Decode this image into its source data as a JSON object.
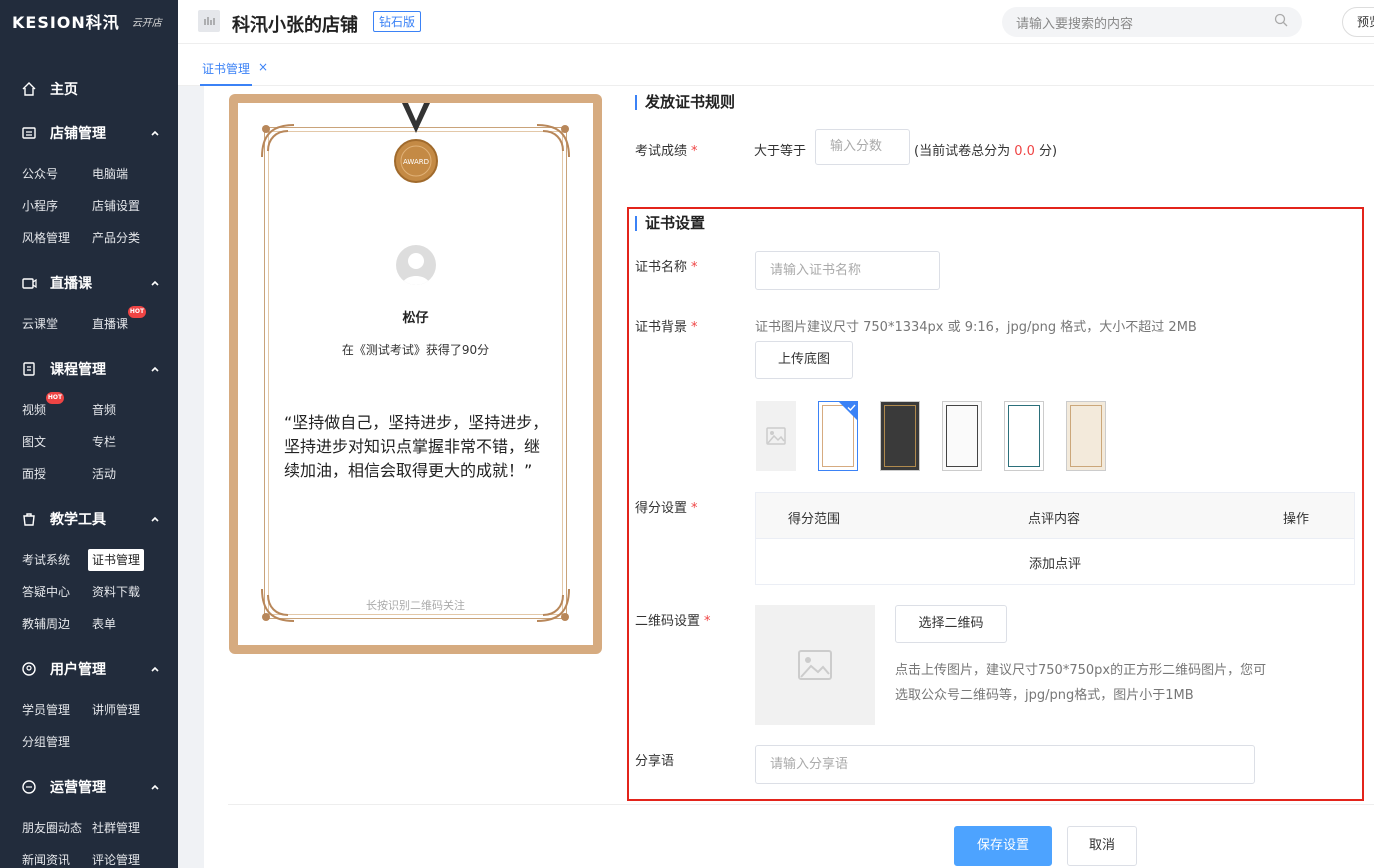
{
  "sidebar": {
    "logo": "KESION科汛",
    "logo_sub": "云开店",
    "home": "主页",
    "groups": {
      "store": "店铺管理",
      "live": "直播课",
      "course": "课程管理",
      "tools": "教学工具",
      "users": "用户管理",
      "ops": "运营管理"
    },
    "items": {
      "gongzhonghao": "公众号",
      "pc": "电脑端",
      "miniapp": "小程序",
      "store_settings": "店铺设置",
      "style": "风格管理",
      "category": "产品分类",
      "cloud_class": "云课堂",
      "live_class": "直播课",
      "video": "视频",
      "audio": "音频",
      "article": "图文",
      "column": "专栏",
      "face": "面授",
      "activity": "活动",
      "exam": "考试系统",
      "cert": "证书管理",
      "qa": "答疑中心",
      "download": "资料下载",
      "aux": "教辅周边",
      "form": "表单",
      "students": "学员管理",
      "teachers": "讲师管理",
      "groups": "分组管理",
      "moments": "朋友圈动态",
      "community": "社群管理",
      "news": "新闻资讯",
      "comments": "评论管理"
    },
    "hot_label": "HOT"
  },
  "header": {
    "store_name": "科汛小张的店铺",
    "badge": "钻石版",
    "search_placeholder": "请输入要搜索的内容",
    "preview": "预览"
  },
  "tabs": [
    {
      "label": "证书管理",
      "close": "×"
    }
  ],
  "certificate": {
    "medal": "AWARD",
    "name": "松仔",
    "score_text": "在《测试考试》获得了90分",
    "quote": "“坚持做自己，坚持进步，坚持进步，坚持进步对知识点掌握非常不错，继续加油，相信会取得更大的成就！”",
    "footer": "长按识别二维码关注"
  },
  "rules": {
    "title": "发放证书规则",
    "score_label": "考试成绩",
    "score_prefix": "大于等于",
    "score_placeholder": "输入分数",
    "score_hint_pre": "(当前试卷总分为",
    "score_total": "0.0",
    "score_hint_post": "分)"
  },
  "settings": {
    "title": "证书设置",
    "name_label": "证书名称",
    "name_placeholder": "请输入证书名称",
    "bg_label": "证书背景",
    "bg_hint": "证书图片建议尺寸 750*1334px 或 9:16，jpg/png 格式，大小不超过 2MB",
    "upload_btn": "上传底图",
    "score_label": "得分设置",
    "col_range": "得分范围",
    "col_comment": "点评内容",
    "col_action": "操作",
    "add_comment": "添加点评",
    "qr_label": "二维码设置",
    "qr_btn": "选择二维码",
    "qr_hint1": "点击上传图片，建议尺寸750*750px的正方形二维码图片，您可",
    "qr_hint2": "选取公众号二维码等，jpg/png格式，图片小于1MB",
    "share_label": "分享语",
    "share_placeholder": "请输入分享语",
    "required_mark": "*"
  },
  "footer": {
    "save": "保存设置",
    "cancel": "取消"
  },
  "colors": {
    "accent": "#3b82f6",
    "primary_button": "#4da3ff",
    "highlight_box": "#e3241b",
    "cert_frame": "#d6ab80",
    "sidebar_bg": "#222c3c"
  }
}
